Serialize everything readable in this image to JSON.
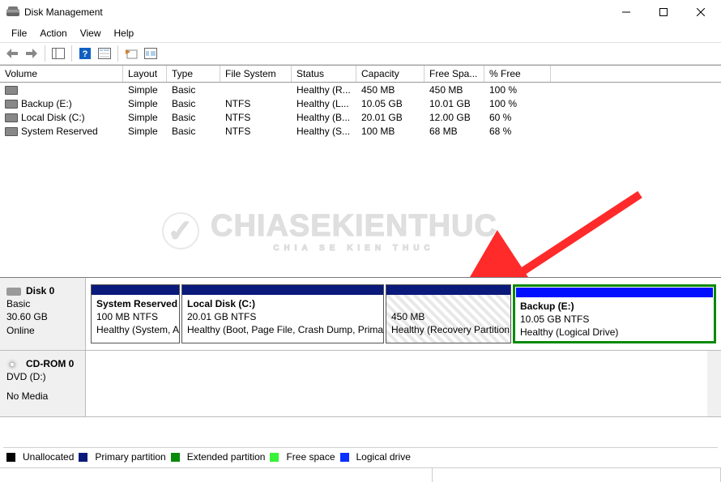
{
  "window": {
    "title": "Disk Management"
  },
  "menu": {
    "file": "File",
    "action": "Action",
    "view": "View",
    "help": "Help"
  },
  "columns": {
    "volume": "Volume",
    "layout": "Layout",
    "type": "Type",
    "fs": "File System",
    "status": "Status",
    "capacity": "Capacity",
    "free": "Free Spa...",
    "pct": "% Free"
  },
  "rows": [
    {
      "name": "",
      "layout": "Simple",
      "type": "Basic",
      "fs": "",
      "status": "Healthy (R...",
      "cap": "450 MB",
      "free": "450 MB",
      "pct": "100 %",
      "selected": true
    },
    {
      "name": "Backup (E:)",
      "layout": "Simple",
      "type": "Basic",
      "fs": "NTFS",
      "status": "Healthy (L...",
      "cap": "10.05 GB",
      "free": "10.01 GB",
      "pct": "100 %"
    },
    {
      "name": "Local Disk (C:)",
      "layout": "Simple",
      "type": "Basic",
      "fs": "NTFS",
      "status": "Healthy (B...",
      "cap": "20.01 GB",
      "free": "12.00 GB",
      "pct": "60 %"
    },
    {
      "name": "System Reserved",
      "layout": "Simple",
      "type": "Basic",
      "fs": "NTFS",
      "status": "Healthy (S...",
      "cap": "100 MB",
      "free": "68 MB",
      "pct": "68 %"
    }
  ],
  "disk0": {
    "name": "Disk 0",
    "type": "Basic",
    "size": "30.60 GB",
    "state": "Online",
    "p1": {
      "name": "System Reserved",
      "line2": "100 MB NTFS",
      "line3": "Healthy (System, A"
    },
    "p2": {
      "name": "Local Disk  (C:)",
      "line2": "20.01 GB NTFS",
      "line3": "Healthy (Boot, Page File, Crash Dump, Primar"
    },
    "p3": {
      "line2": "450 MB",
      "line3": "Healthy (Recovery Partition"
    },
    "p4": {
      "name": "Backup  (E:)",
      "line2": "10.05 GB NTFS",
      "line3": "Healthy (Logical Drive)"
    }
  },
  "cdrom": {
    "name": "CD-ROM 0",
    "line2": "DVD (D:)",
    "line3": "No Media"
  },
  "legend": {
    "unalloc": "Unallocated",
    "primary": "Primary partition",
    "ext": "Extended partition",
    "free": "Free space",
    "logical": "Logical drive"
  },
  "colors": {
    "black": "#000000",
    "primary": "#0a1a7a",
    "ext": "#0a8a0a",
    "free": "#38f238",
    "logical": "#0a30ff"
  }
}
